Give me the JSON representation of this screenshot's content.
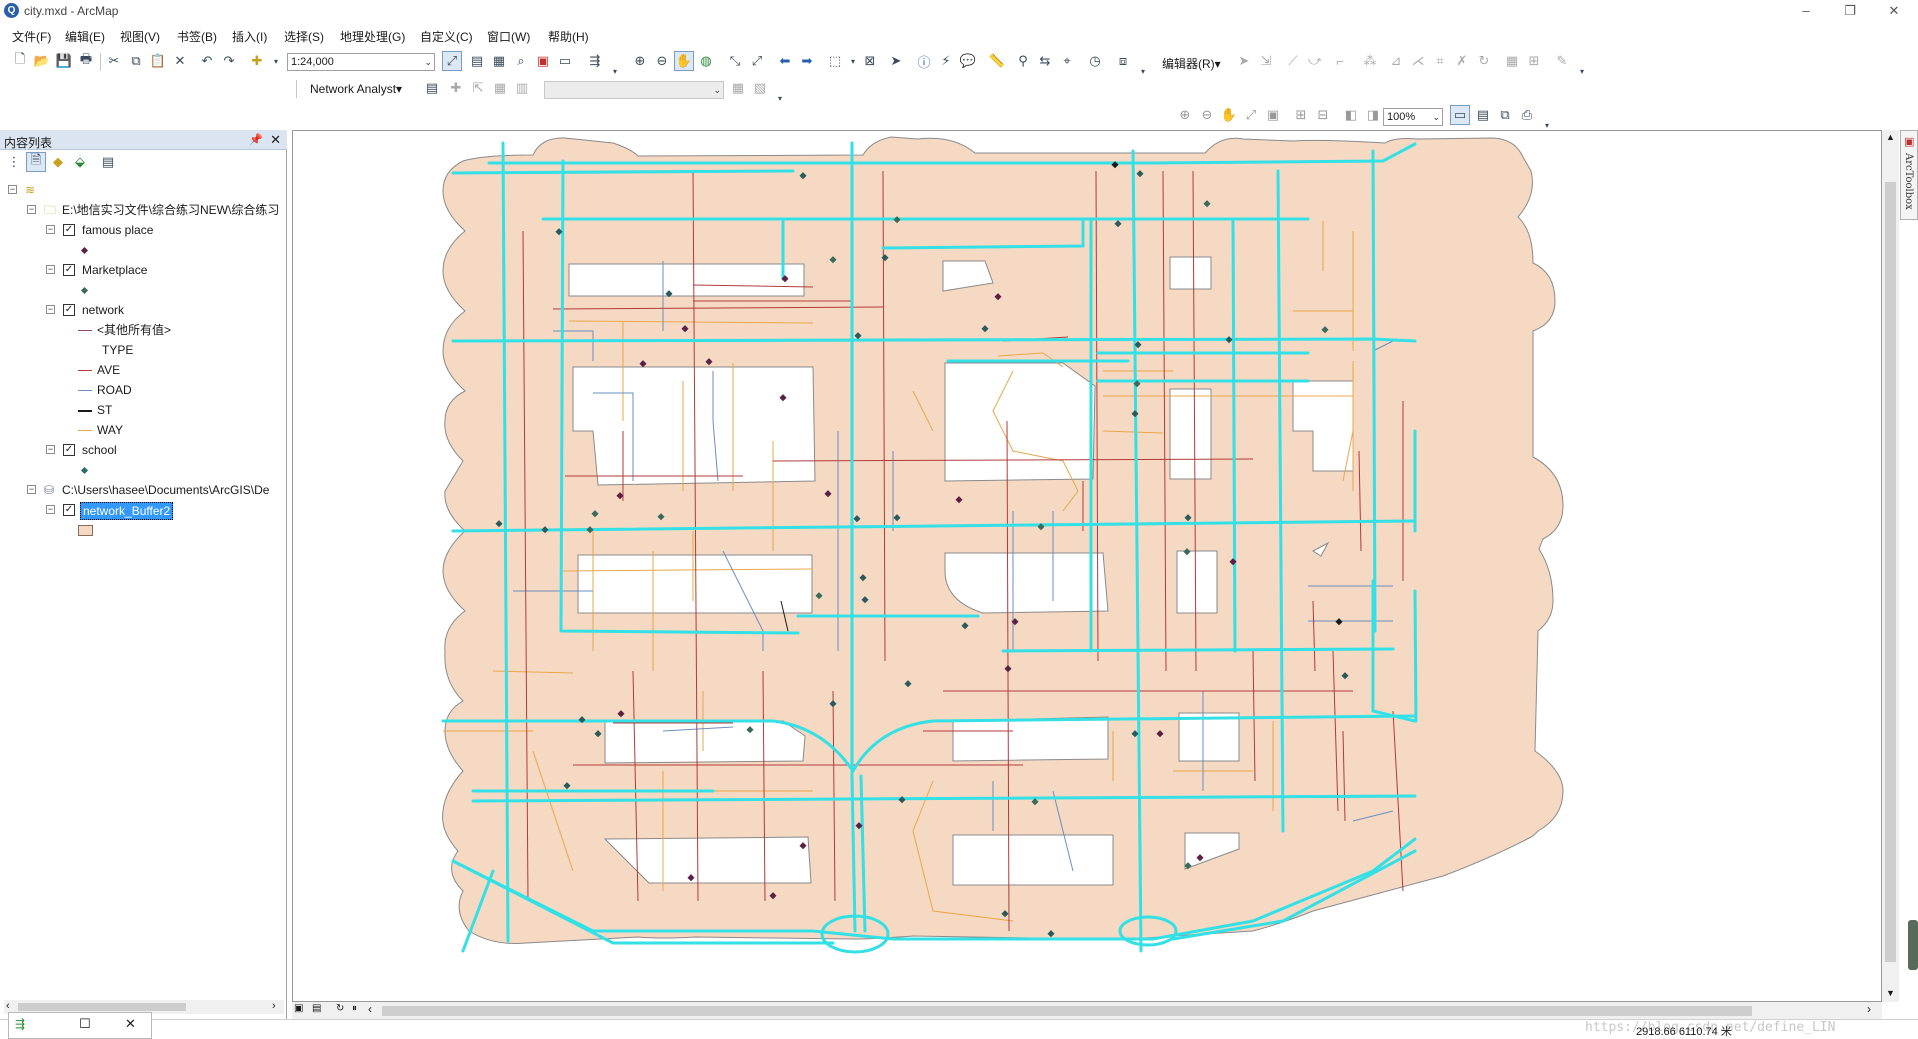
{
  "window": {
    "title": "city.mxd - ArcMap",
    "app_icon": "arcmap-globe-icon"
  },
  "menu": [
    "文件(F)",
    "编辑(E)",
    "视图(V)",
    "书签(B)",
    "插入(I)",
    "选择(S)",
    "地理处理(G)",
    "自定义(C)",
    "窗口(W)",
    "帮助(H)"
  ],
  "toolbar": {
    "scale": "1:24,000",
    "editor_label": "编辑器(R)▾",
    "network_analyst_label": "Network Analyst▾",
    "zoom_percent": "100%"
  },
  "toc": {
    "title": "内容列表",
    "tree": {
      "folder_path": "E:\\地信实习文件\\综合练习NEW\\综合练习",
      "gdb_path": "C:\\Users\\hasee\\Documents\\ArcGIS\\De",
      "layers": {
        "famous_place": "famous place",
        "marketplace": "Marketplace",
        "network": "network",
        "network_other": "<其他所有值>",
        "network_field": "TYPE",
        "ave": "AVE",
        "road": "ROAD",
        "st": "ST",
        "way": "WAY",
        "school": "school",
        "buffer": "network_Buffer2"
      }
    }
  },
  "map": {
    "colors": {
      "buffer_fill": "#f5d9c3",
      "buffer_stroke": "#8a8a8a",
      "cyan_road": "#33e0e6",
      "ave": "#b23a3a",
      "road": "#6a8fc0",
      "st": "#1a1a1a",
      "way": "#e8a84a",
      "point": "#5a2046"
    }
  },
  "toolbox_tab": "ArcToolbox",
  "status": {
    "coordinates": "2918.66  6110.74 米",
    "watermark": "https://blog.csdn.net/define_LIN"
  }
}
